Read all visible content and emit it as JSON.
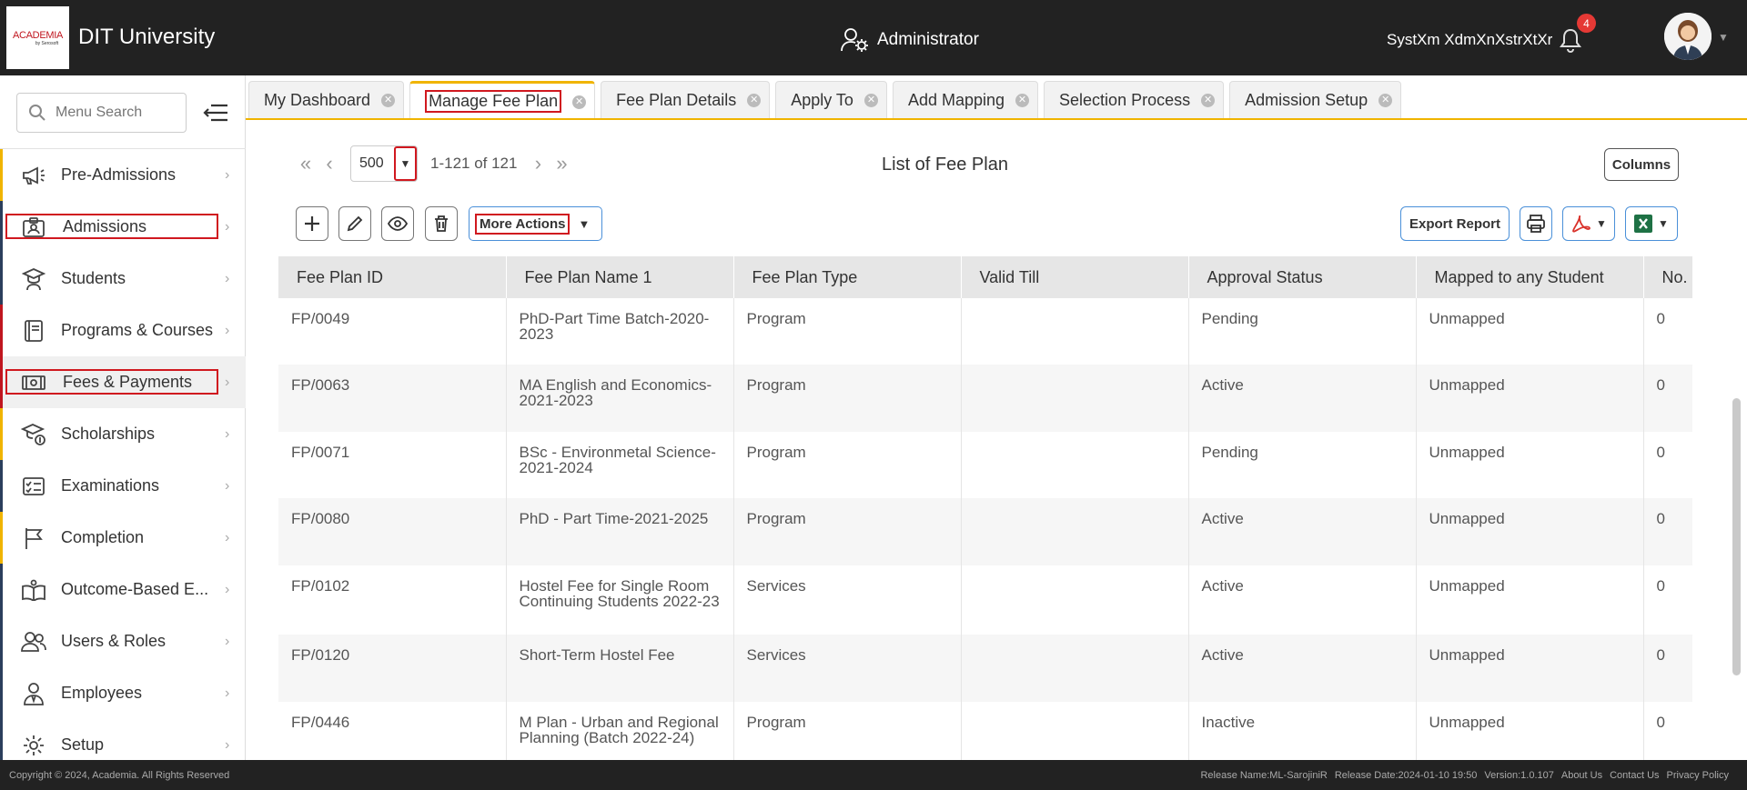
{
  "header": {
    "logo_text": "ACADEMIA",
    "logo_sub": "by Serosoft",
    "university": "DIT University",
    "role": "Administrator",
    "username": "SystXm XdmXnXstrXtXr",
    "notification_count": "4"
  },
  "sidebar": {
    "search_placeholder": "Menu Search",
    "items": [
      {
        "label": "Pre-Admissions",
        "icon": "megaphone-icon"
      },
      {
        "label": "Admissions",
        "icon": "id-card-icon"
      },
      {
        "label": "Students",
        "icon": "graduate-icon"
      },
      {
        "label": "Programs & Courses",
        "icon": "book-icon"
      },
      {
        "label": "Fees & Payments",
        "icon": "money-icon"
      },
      {
        "label": "Scholarships",
        "icon": "scholarship-icon"
      },
      {
        "label": "Examinations",
        "icon": "checklist-icon"
      },
      {
        "label": "Completion",
        "icon": "flag-icon"
      },
      {
        "label": "Outcome-Based E...",
        "icon": "open-book-icon"
      },
      {
        "label": "Users & Roles",
        "icon": "users-icon"
      },
      {
        "label": "Employees",
        "icon": "employee-icon"
      },
      {
        "label": "Setup",
        "icon": "gear-icon"
      }
    ]
  },
  "tabs": [
    {
      "label": "My Dashboard"
    },
    {
      "label": "Manage Fee Plan"
    },
    {
      "label": "Fee Plan Details"
    },
    {
      "label": "Apply To"
    },
    {
      "label": "Add Mapping"
    },
    {
      "label": "Selection Process"
    },
    {
      "label": "Admission Setup"
    }
  ],
  "pager": {
    "page_size": "500",
    "count": "1-121 of 121"
  },
  "list": {
    "title": "List of Fee Plan",
    "columns_label": "Columns",
    "more_actions": "More Actions",
    "export_report": "Export Report"
  },
  "table": {
    "headers": [
      "Fee Plan ID",
      "Fee Plan Name 1",
      "Fee Plan Type",
      "Valid Till",
      "Approval Status",
      "Mapped to any Student",
      "No."
    ],
    "rows": [
      [
        "FP/0049",
        "PhD-Part Time Batch-2020-2023",
        "Program",
        "",
        "Pending",
        "Unmapped",
        "0"
      ],
      [
        "FP/0063",
        "MA English and Economics-2021-2023",
        "Program",
        "",
        "Active",
        "Unmapped",
        "0"
      ],
      [
        "FP/0071",
        "BSc - Environmetal Science-2021-2024",
        "Program",
        "",
        "Pending",
        "Unmapped",
        "0"
      ],
      [
        "FP/0080",
        "PhD - Part Time-2021-2025",
        "Program",
        "",
        "Active",
        "Unmapped",
        "0"
      ],
      [
        "FP/0102",
        "Hostel Fee for Single Room Continuing Students 2022-23",
        "Services",
        "",
        "Active",
        "Unmapped",
        "0"
      ],
      [
        "FP/0120",
        "Short-Term Hostel Fee",
        "Services",
        "",
        "Active",
        "Unmapped",
        "0"
      ],
      [
        "FP/0446",
        "M Plan - Urban and Regional Planning (Batch 2022-24)",
        "Program",
        "",
        "Inactive",
        "Unmapped",
        "0"
      ]
    ]
  },
  "footer": {
    "copyright": "Copyright © 2024, Academia. All Rights Reserved",
    "release_name": "Release Name:ML-SarojiniR",
    "release_date": "Release Date:2024-01-10 19:50",
    "version": "Version:1.0.107",
    "about": "About Us",
    "contact": "Contact Us",
    "privacy": "Privacy Policy"
  }
}
